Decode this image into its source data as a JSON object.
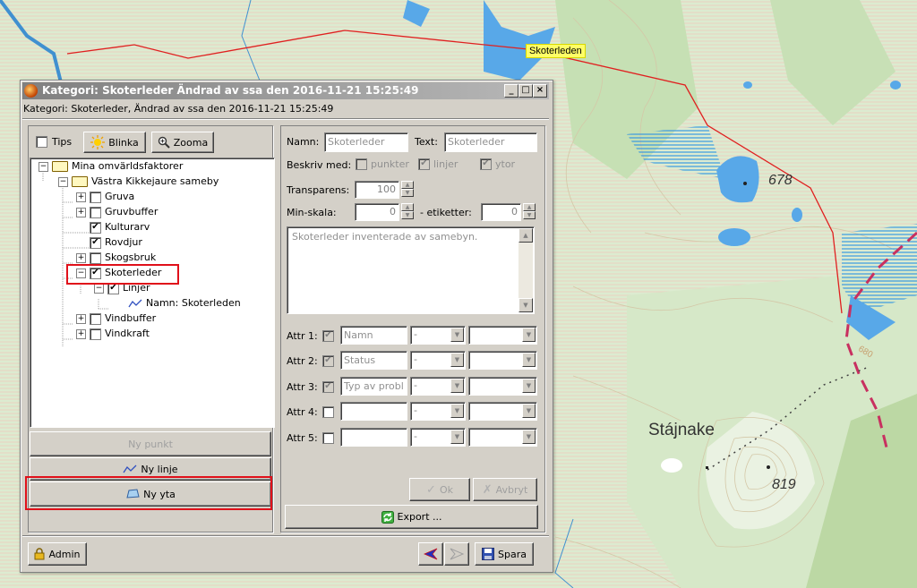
{
  "map": {
    "route_label": "Skoterleden",
    "place_name": "Stájnake",
    "elevation_1": "678",
    "elevation_2": "819",
    "contour_label": "680"
  },
  "window": {
    "title": "Kategori: Skoterleder Ändrad av ssa den 2016-11-21 15:25:49",
    "subtitle": "Kategori: Skoterleder, Ändrad av ssa den 2016-11-21 15:25:49",
    "controls": [
      "_",
      "□",
      "×"
    ]
  },
  "toolbar": {
    "tips_label": "Tips",
    "tips_checked": false,
    "blinka_label": "Blinka",
    "zooma_label": "Zooma"
  },
  "tree": {
    "root": "Mina omvärldsfaktorer",
    "group": "Västra Kikkejaure sameby",
    "items": [
      {
        "label": "Gruva",
        "checked": false,
        "expander": "+"
      },
      {
        "label": "Gruvbuffer",
        "checked": false,
        "expander": "+"
      },
      {
        "label": "Kulturarv",
        "checked": true,
        "expander": ""
      },
      {
        "label": "Rovdjur",
        "checked": true,
        "expander": ""
      },
      {
        "label": "Skogsbruk",
        "checked": false,
        "expander": "+"
      },
      {
        "label": "Skoterleder",
        "checked": true,
        "expander": "−"
      },
      {
        "label": "Vindbuffer",
        "checked": false,
        "expander": "+"
      },
      {
        "label": "Vindkraft",
        "checked": false,
        "expander": "+"
      }
    ],
    "sub_item": {
      "label": "Linjer",
      "checked": true
    },
    "leaf": "Namn: Skoterleden"
  },
  "left_buttons": {
    "new_point": "Ny punkt",
    "new_line": "Ny linje",
    "new_area": "Ny yta"
  },
  "form": {
    "namn_label": "Namn:",
    "namn_value": "Skoterleder",
    "text_label": "Text:",
    "text_value": "Skoterleder",
    "describe_label": "Beskriv med:",
    "opt_points": "punkter",
    "opt_lines": "linjer",
    "opt_areas": "ytor",
    "transparency_label": "Transparens:",
    "transparency_value": "100",
    "min_scale_label": "Min-skala:",
    "min_scale_value": "0",
    "labels_label": "- etiketter:",
    "labels_value": "0",
    "description": "Skoterleder inventerade av samebyn.",
    "attrs": [
      {
        "label": "Attr 1:",
        "checked": true,
        "value": "Namn",
        "combo1": "-",
        "combo2": ""
      },
      {
        "label": "Attr 2:",
        "checked": true,
        "value": "Status",
        "combo1": "-",
        "combo2": ""
      },
      {
        "label": "Attr 3:",
        "checked": true,
        "value": "Typ av probl",
        "combo1": "-",
        "combo2": ""
      },
      {
        "label": "Attr 4:",
        "checked": false,
        "value": "",
        "combo1": "-",
        "combo2": ""
      },
      {
        "label": "Attr 5:",
        "checked": false,
        "value": "",
        "combo1": "-",
        "combo2": ""
      }
    ],
    "ok_label": "Ok",
    "cancel_label": "Avbryt",
    "export_label": "Export ..."
  },
  "footer": {
    "admin_label": "Admin",
    "save_label": "Spara"
  },
  "colors": {
    "highlight": "#e0101a",
    "route": "#e02020",
    "window_bg": "#d4d0c8",
    "map_bg": "#dcebd0",
    "water": "#58a8e8"
  }
}
